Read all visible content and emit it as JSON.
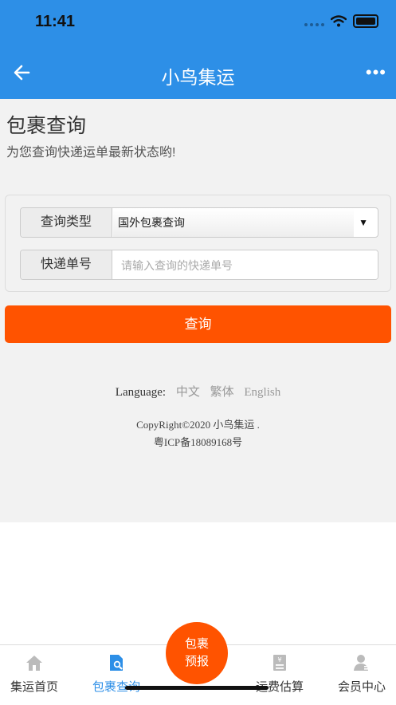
{
  "status_bar": {
    "time": "11:41"
  },
  "navbar": {
    "title": "小鸟集运",
    "more": "•••"
  },
  "page": {
    "title": "包裹查询",
    "subtitle": "为您查询快递运单最新状态哟!"
  },
  "form": {
    "type_label": "查询类型",
    "type_value": "国外包裹查询",
    "tracking_label": "快递单号",
    "tracking_placeholder": "请输入查询的快递单号",
    "tracking_value": ""
  },
  "query_button": "查询",
  "language": {
    "label": "Language:",
    "options": [
      "中文",
      "繁体",
      "English"
    ]
  },
  "footer": {
    "copyright": "CopyRight©2020 小鸟集运 .",
    "icp": "粤ICP备18089168号"
  },
  "tabbar": {
    "tabs": [
      {
        "label": "集运首页",
        "icon": "home-icon"
      },
      {
        "label": "包裹查询",
        "icon": "parcel-search-icon",
        "active": true
      },
      {
        "label": "运费估算",
        "icon": "freight-estimate-icon"
      },
      {
        "label": "会员中心",
        "icon": "member-icon"
      }
    ],
    "fab_line1": "包裹",
    "fab_line2": "预报"
  },
  "colors": {
    "primary": "#2d8fe7",
    "accent": "#ff5300"
  }
}
